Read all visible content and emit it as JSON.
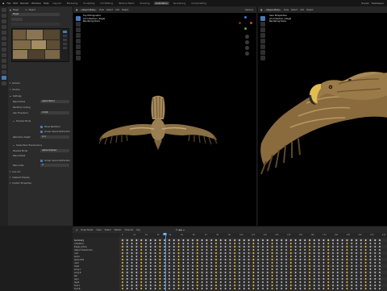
{
  "topbar": {
    "menus": [
      "File",
      "Edit",
      "Render",
      "Window",
      "Help"
    ],
    "tabs": [
      "Layout",
      "Modeling",
      "Sculpting",
      "UV Editing",
      "Texture Paint",
      "Shading",
      "Animation",
      "Rendering",
      "Compositing",
      "Geometry Nodes",
      "Scripting"
    ],
    "active_tab": "Animation",
    "scene_label": "Scene",
    "view_layer_label": "ViewLayer"
  },
  "properties": {
    "object_name": "Eagle",
    "mode_label": "Object",
    "sections": {
      "surface": "Surface",
      "volume": "Volume",
      "settings": "Settings",
      "backface": "Backface Culling",
      "alpha_blend": "Blend Mode",
      "blend_value": "Alpha Blend",
      "shadow_mode": "Shadow Mode",
      "shadow_value": "Alpha Hashed",
      "clip_threshold": "Clip Threshold",
      "clip_value": "0.500",
      "show_backface": "Show Backface",
      "screen_space": "Screen Space Refraction",
      "refraction_depth": "Refraction Depth",
      "refraction_value": "0 m",
      "subsurface": "Subsurface Translucency",
      "pass_index": "Pass Index",
      "pass_value": "0",
      "line_art": "Line Art",
      "viewport_display": "Viewport Display",
      "custom_props": "Custom Properties"
    }
  },
  "viewport_left": {
    "mode": "Object Mode",
    "menus": [
      "View",
      "Select",
      "Add",
      "Object"
    ],
    "info_lines": [
      "Top Orthographic",
      "(0) Collection | Eagle",
      "Rendering Done"
    ],
    "options_label": "Options"
  },
  "viewport_right": {
    "mode": "Object Mode",
    "menus": [
      "View",
      "Select",
      "Add",
      "Object"
    ],
    "info_lines": [
      "User Perspective",
      "(0) Collection | Eagle",
      "Rendering Done"
    ]
  },
  "timeline": {
    "editor_label": "Dope Sheet",
    "menus": [
      "View",
      "Select",
      "Marker",
      "Channel",
      "Key"
    ],
    "mode_label": "Action Editor",
    "current_frame": "36",
    "ruler_ticks": [
      "0",
      "10",
      "20",
      "30",
      "40",
      "50",
      "60",
      "70",
      "80",
      "90",
      "100",
      "110",
      "120",
      "130",
      "140",
      "150",
      "160",
      "170",
      "180",
      "190",
      "200",
      "210",
      "220"
    ],
    "channels": [
      "Summary",
      "Armature",
      "Eagle_Action",
      "Object Transforms",
      "root",
      "spine",
      "spine.001",
      "neck",
      "head",
      "wing.L",
      "wing.R",
      "tail",
      "leg.L",
      "leg.R",
      "foot.L",
      "foot.R"
    ]
  }
}
